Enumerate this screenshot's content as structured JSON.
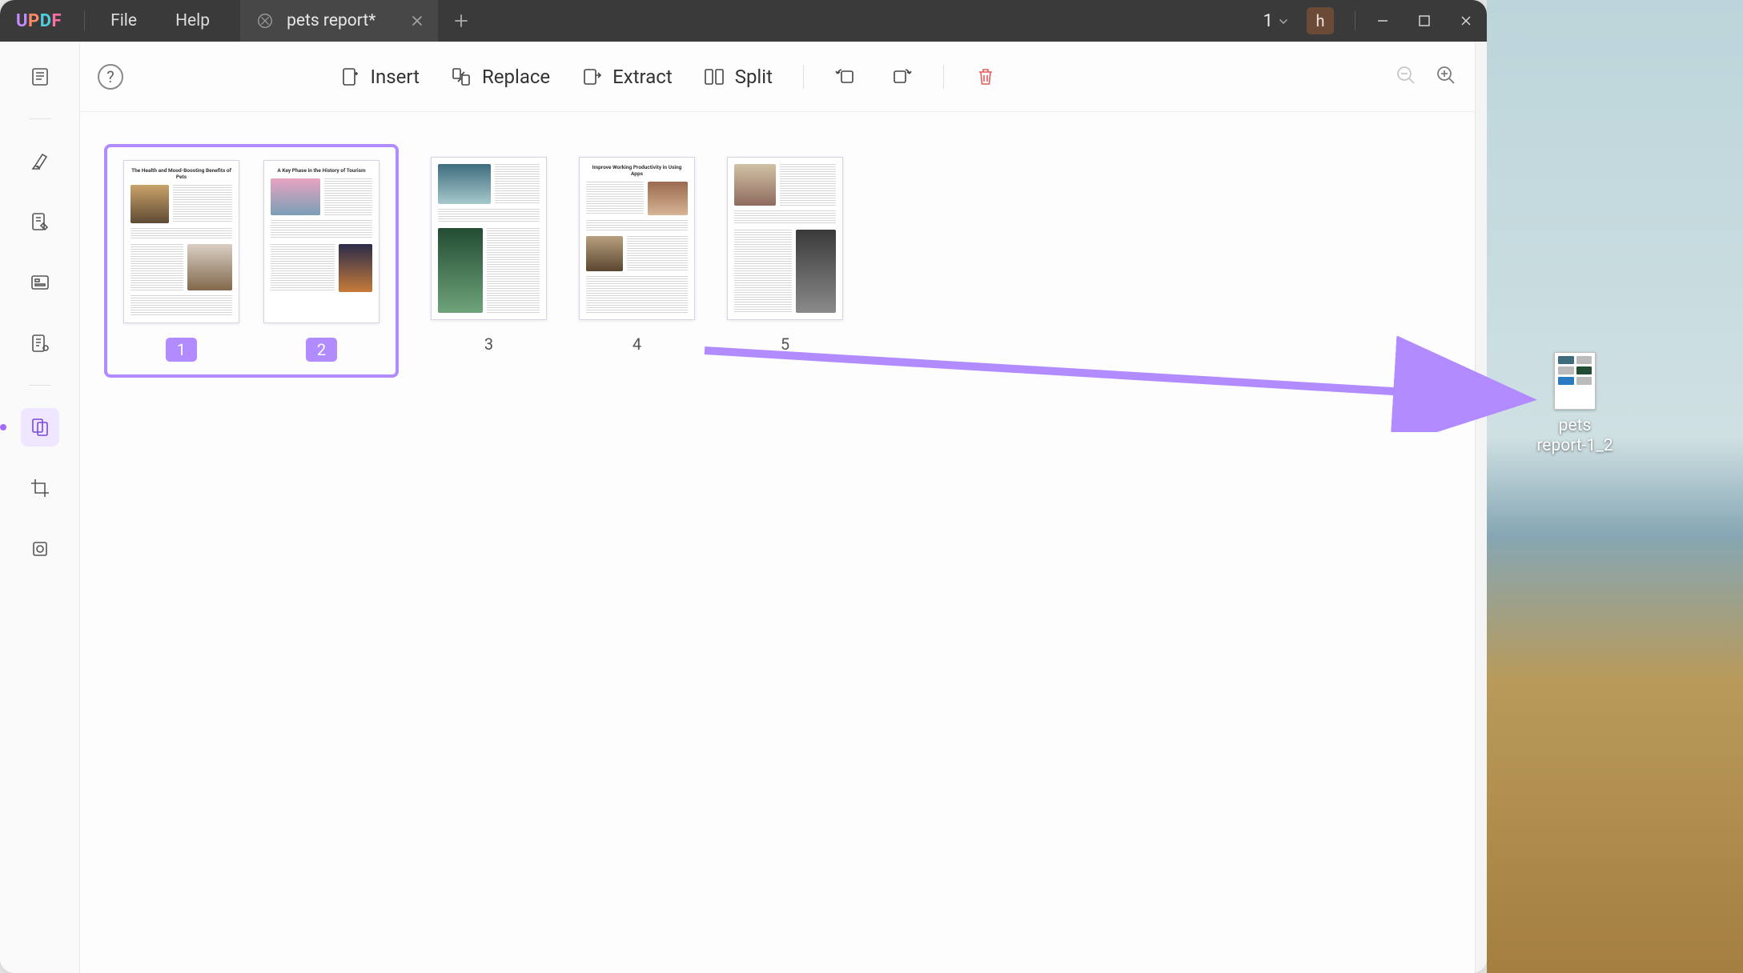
{
  "titlebar": {
    "brand": "UPDF",
    "menu": {
      "file": "File",
      "help": "Help"
    },
    "tab": {
      "title": "pets report*"
    },
    "tab_count": "1",
    "user_initial": "h"
  },
  "toolbar": {
    "insert": "Insert",
    "replace": "Replace",
    "extract": "Extract",
    "split": "Split"
  },
  "pages": [
    {
      "num": "1",
      "selected": true,
      "title": "The Health and Mood-Boosting Benefits of Pets"
    },
    {
      "num": "2",
      "selected": true,
      "title": "A Key Phase in the History of Tourism"
    },
    {
      "num": "3",
      "selected": false,
      "title": ""
    },
    {
      "num": "4",
      "selected": false,
      "title": "Improve Working Productivity in Using Apps"
    },
    {
      "num": "5",
      "selected": false,
      "title": ""
    }
  ],
  "desktop": {
    "file_label_line1": "pets",
    "file_label_line2": "report-1_2"
  },
  "colors": {
    "accent": "#b18bff",
    "danger": "#e35b5b"
  }
}
